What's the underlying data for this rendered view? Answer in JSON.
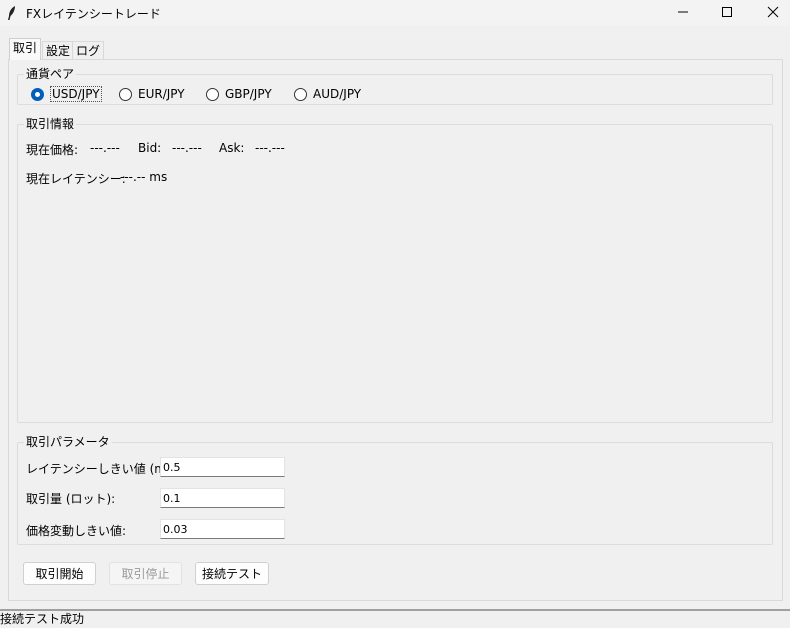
{
  "window": {
    "title": "FXレイテンシートレード",
    "icons": {
      "app": "feather-icon",
      "minimize": "minimize-icon",
      "maximize": "maximize-icon",
      "close": "close-icon"
    }
  },
  "tabs": [
    {
      "label": "取引",
      "active": true
    },
    {
      "label": "設定",
      "active": false
    },
    {
      "label": "ログ",
      "active": false
    }
  ],
  "currency_pair": {
    "group_label": "通貨ペア",
    "options": [
      "USD/JPY",
      "EUR/JPY",
      "GBP/JPY",
      "AUD/JPY"
    ],
    "selected": "USD/JPY"
  },
  "trade_info": {
    "group_label": "取引情報",
    "current_price_label": "現在価格:",
    "current_price_value": "---.---",
    "bid_label": "Bid:",
    "bid_value": "---.---",
    "ask_label": "Ask:",
    "ask_value": "---.---",
    "latency_label": "現在レイテンシー:",
    "latency_value": "---.-- ms"
  },
  "trade_params": {
    "group_label": "取引パラメータ",
    "latency_threshold_label": "レイテンシーしきい値 (ms):",
    "latency_threshold_value": "0.5",
    "lot_label": "取引量 (ロット):",
    "lot_value": "0.1",
    "price_change_label": "価格変動しきい値:",
    "price_change_value": "0.03"
  },
  "buttons": {
    "start": "取引開始",
    "stop": "取引停止",
    "test": "接続テスト"
  },
  "status": "接続テスト成功",
  "colors": {
    "accent": "#005fb8",
    "background": "#f0f0f0"
  }
}
